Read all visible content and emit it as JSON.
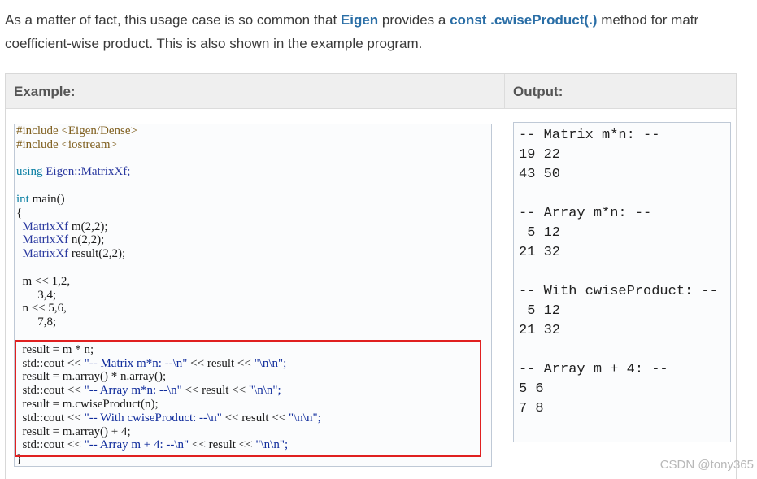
{
  "intro": {
    "line1_pre": "As a matter of fact, this usage case is so common that ",
    "eigen": "Eigen",
    "line1_mid": " provides a ",
    "method": "const .cwiseProduct(.)",
    "line1_post": " method for matr",
    "line2": "coefficient-wise product. This is also shown in the example program."
  },
  "headers": {
    "example": "Example:",
    "output": "Output:"
  },
  "code": {
    "l1": "#include <Eigen/Dense>",
    "l2": "#include <iostream>",
    "l3_kw": "using",
    "l3_rest": " Eigen::MatrixXf;",
    "l4_kw": "int",
    "l4_rest": " main()",
    "l5": "{",
    "decl_type": "MatrixXf",
    "decl1": " m(2,2);",
    "decl2": " n(2,2);",
    "decl3": " result(2,2);",
    "m1": "m << 1,2,",
    "m2": "     3,4;",
    "n1": "n << 5,6,",
    "n2": "     7,8;",
    "r1": "result = m * n;",
    "c1a": "std::cout << ",
    "c1s": "\"-- Matrix m*n: --\\n\"",
    "c1b": " << result << ",
    "c1e": "\"\\n\\n\";",
    "r2": "result = m.array() * n.array();",
    "c2a": "std::cout << ",
    "c2s": "\"-- Array m*n: --\\n\"",
    "c2b": " << result << ",
    "c2e": "\"\\n\\n\";",
    "r3": "result = m.cwiseProduct(n);",
    "c3a": "std::cout << ",
    "c3s": "\"-- With cwiseProduct: --\\n\"",
    "c3b": " << result << ",
    "c3e": "\"\\n\\n\";",
    "r4": "result = m.array() + 4;",
    "c4a": "std::cout << ",
    "c4s": "\"-- Array m + 4: --\\n\"",
    "c4b": " << result << ",
    "c4e": "\"\\n\\n\";",
    "close": "}"
  },
  "output": {
    "o1": "-- Matrix m*n: --",
    "o2": "19 22",
    "o3": "43 50",
    "o4": "-- Array m*n: --",
    "o5": " 5 12",
    "o6": "21 32",
    "o7": "-- With cwiseProduct: --",
    "o8": " 5 12",
    "o9": "21 32",
    "o10": "-- Array m + 4: --",
    "o11": "5 6",
    "o12": "7 8"
  },
  "watermark": "CSDN @tony365",
  "colors": {
    "highlight_box": "#e02020",
    "link": "#2a6ea6"
  }
}
